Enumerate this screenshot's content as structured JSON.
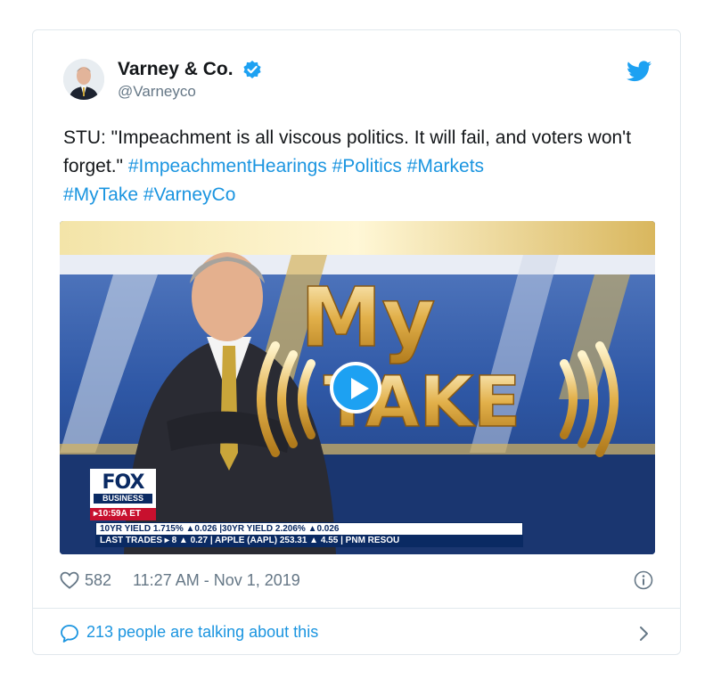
{
  "author": {
    "display_name": "Varney & Co.",
    "handle": "@Varneyco",
    "verified": true
  },
  "tweet": {
    "text_prefix": "STU: \"Impeachment is all viscous politics. It will fail, and voters won't forget.\" ",
    "hashtags": [
      "#ImpeachmentHearings",
      "#Politics",
      "#Markets",
      "#MyTake",
      "#VarneyCo"
    ]
  },
  "media": {
    "type": "video",
    "title_line1": "My",
    "title_line2": "TAKE",
    "network_logo": "FOX",
    "network_sub": "BUSINESS",
    "time_badge": "▸10:59A ET",
    "ticker_row1": "10YR YIELD   1.715% ▲0.026   |30YR YIELD   2.206% ▲0.026",
    "ticker_row2": "LAST TRADES ▸ 8 ▲ 0.27  |  APPLE (AAPL) 253.31 ▲ 4.55  |  PNM RESOU"
  },
  "engagement": {
    "likes": "582",
    "timestamp": "11:27 AM - Nov 1, 2019"
  },
  "footer": {
    "talking": "213 people are talking about this"
  },
  "icons": {
    "verified": "verified-badge-icon",
    "bird": "twitter-bird-icon",
    "heart": "heart-icon",
    "info": "info-icon",
    "bubble": "speech-bubble-icon",
    "chevron": "chevron-right-icon"
  },
  "colors": {
    "link": "#1b95e0",
    "muted": "#657786",
    "border": "#e1e8ed",
    "brand": "#1da1f2"
  }
}
